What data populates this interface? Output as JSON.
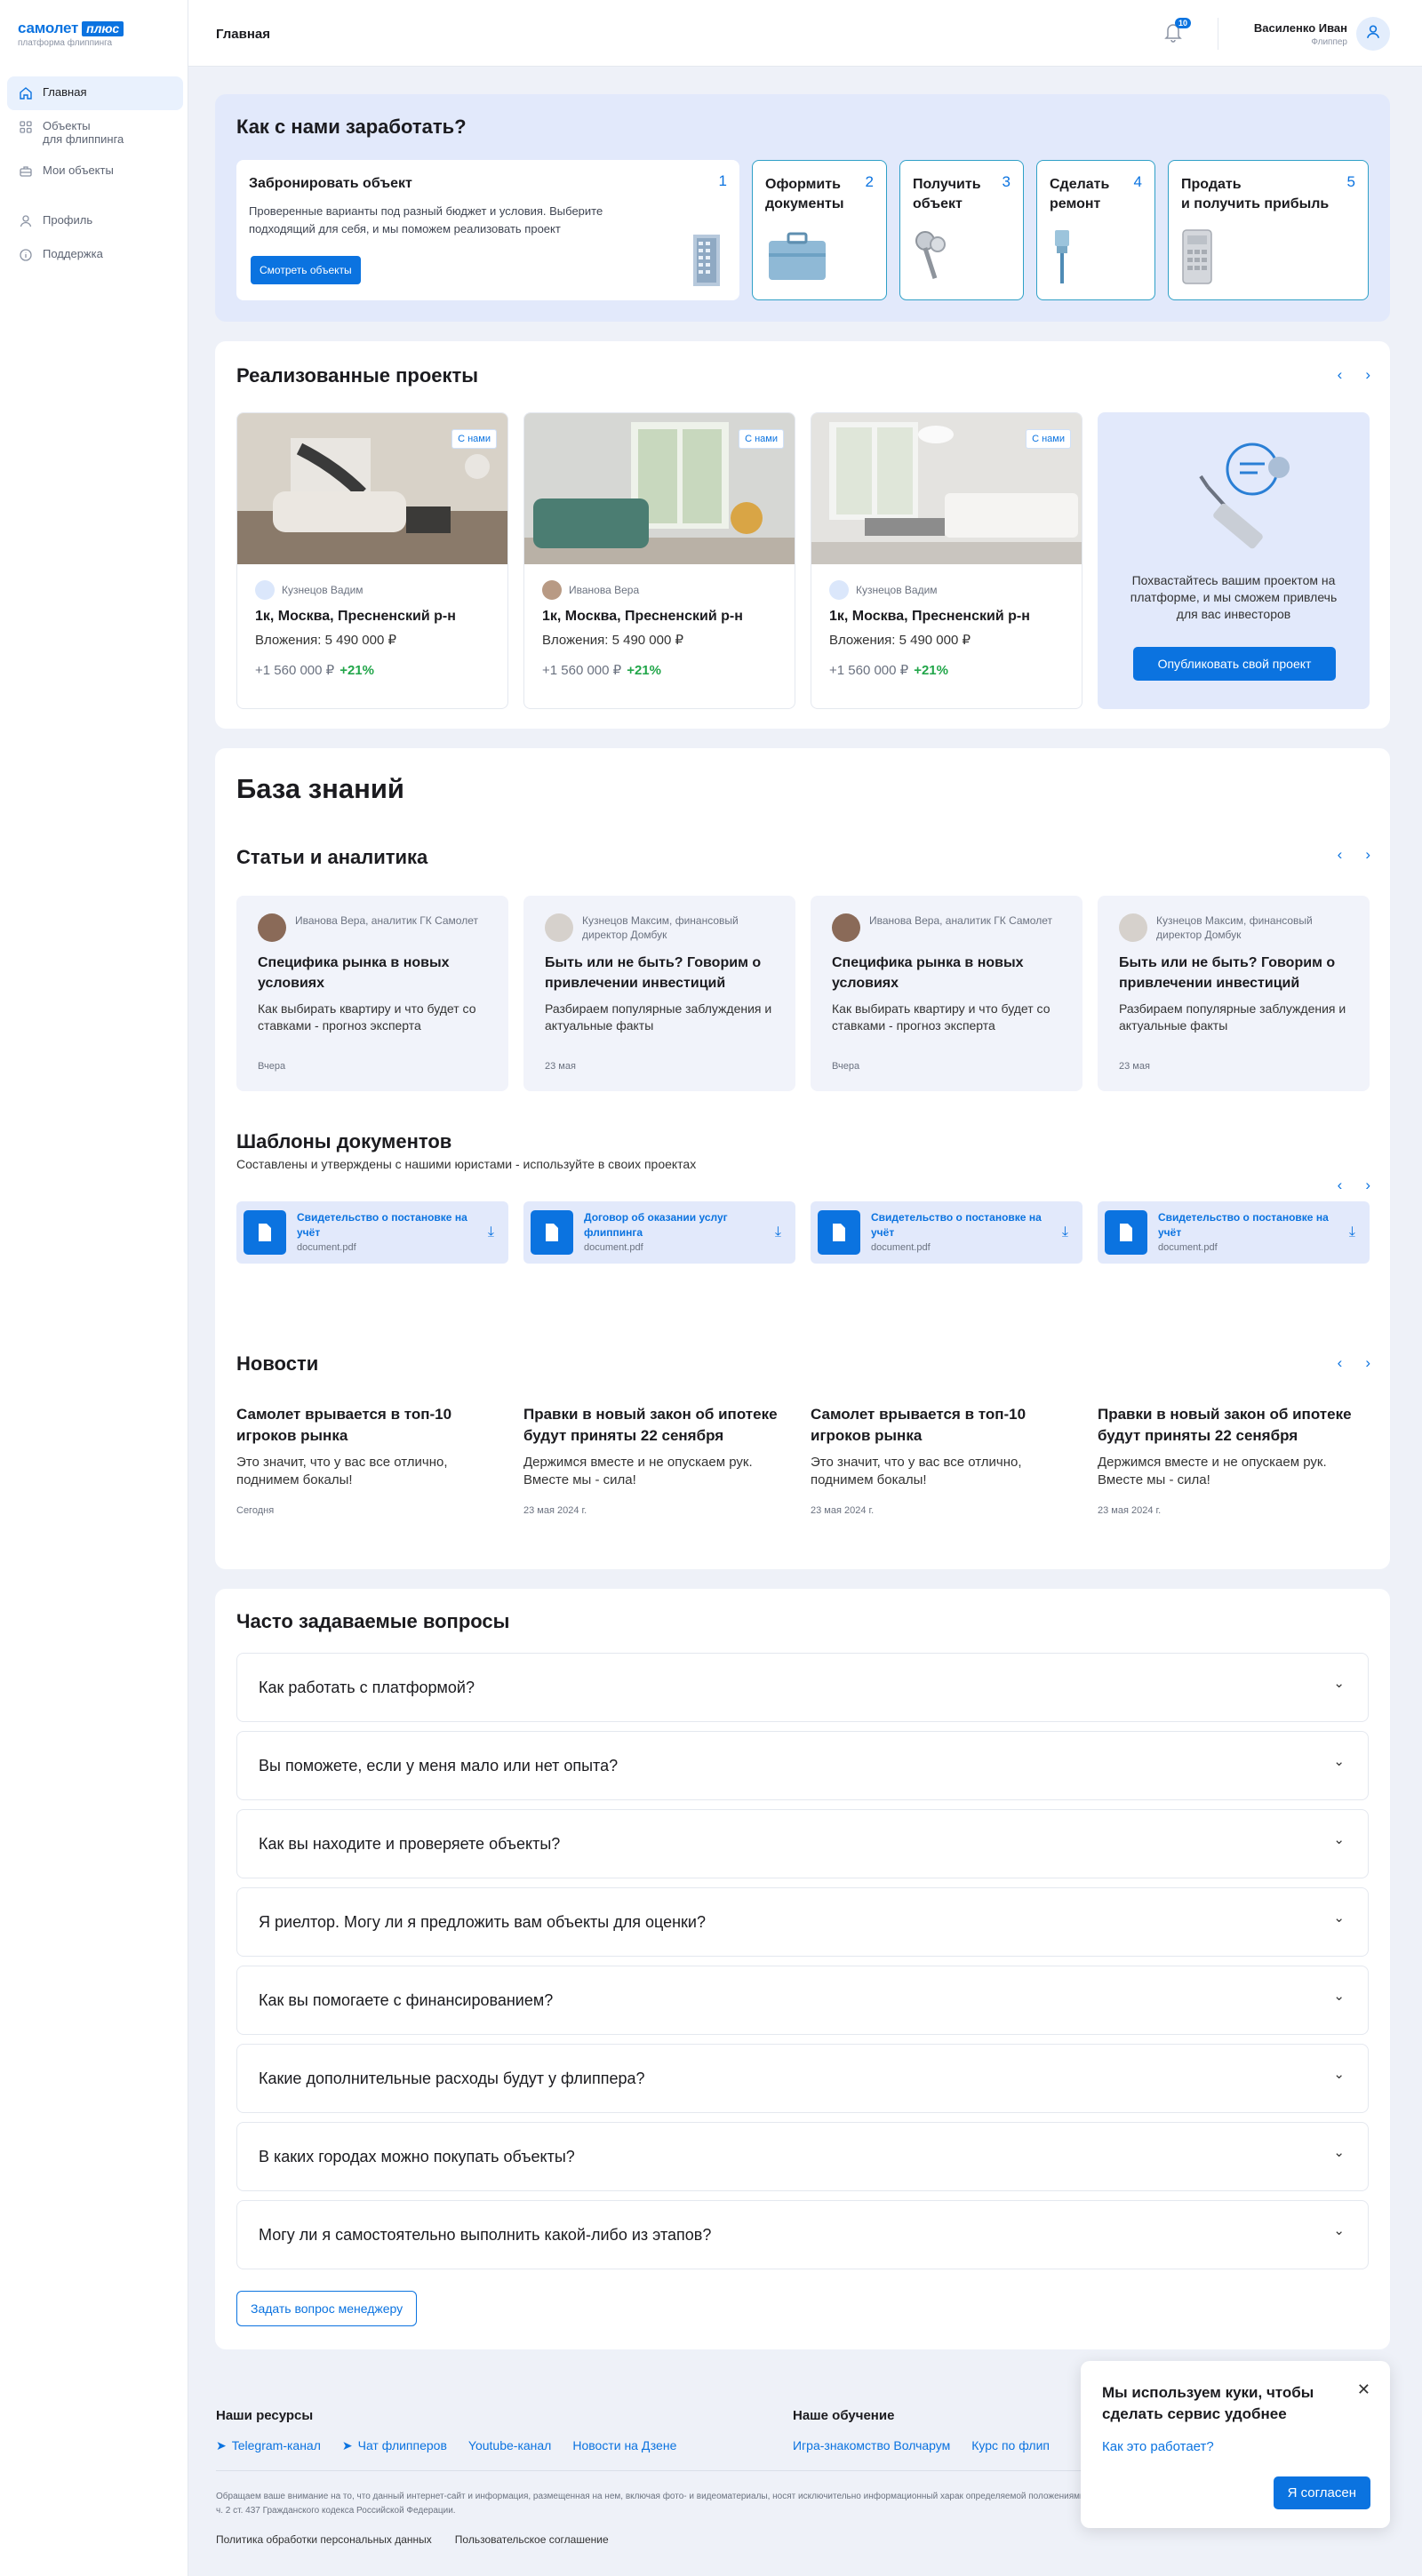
{
  "brand": {
    "name": "самолет",
    "plus": "плюс",
    "tagline": "платформа флиппинга"
  },
  "sidebar": {
    "items": [
      {
        "label": "Главная",
        "icon": "home-icon"
      },
      {
        "label": "Объекты",
        "label2": "для флиппинга",
        "icon": "grid-icon"
      },
      {
        "label": "Мои объекты",
        "icon": "briefcase-icon"
      },
      {
        "label": "Профиль",
        "icon": "person-icon"
      },
      {
        "label": "Поддержка",
        "icon": "info-icon"
      }
    ]
  },
  "header": {
    "breadcrumb": "Главная",
    "notifications": "10",
    "user_name": "Василенко Иван",
    "user_role": "Флиппер"
  },
  "earn": {
    "title": "Как с нами заработать?",
    "steps": [
      {
        "num": "1",
        "title": "Забронировать объект",
        "text": "Проверенные варианты под разный бюджет и условия. Выберите подходящий для себя, и мы поможем реализовать проект",
        "button": "Смотреть объекты"
      },
      {
        "num": "2",
        "title": "Оформить",
        "title2": "документы"
      },
      {
        "num": "3",
        "title": "Получить",
        "title2": "объект"
      },
      {
        "num": "4",
        "title": "Сделать",
        "title2": "ремонт"
      },
      {
        "num": "5",
        "title": "Продать",
        "title2": "и получить прибыль"
      }
    ]
  },
  "projects": {
    "title": "Реализованные проекты",
    "prev": "‹",
    "next": "›",
    "items": [
      {
        "tag": "С нами",
        "author": "Кузнецов Вадим",
        "title": "1к, Москва, Пресненский р-н",
        "invest": "Вложения: 5 490 000 ₽",
        "profit": "+1 560 000 ₽",
        "percent": "+21%"
      },
      {
        "tag": "С нами",
        "author": "Иванова Вера",
        "title": "1к, Москва, Пресненский р-н",
        "invest": "Вложения: 5 490 000 ₽",
        "profit": "+1 560 000 ₽",
        "percent": "+21%"
      },
      {
        "tag": "С нами",
        "author": "Кузнецов Вадим",
        "title": "1к, Москва, Пресненский р-н",
        "invest": "Вложения: 5 490 000 ₽",
        "profit": "+1 560 000 ₽",
        "percent": "+21%"
      }
    ],
    "cta_text": "Похвастайтесь вашим проектом на платформе, и мы сможем привлечь для вас инвесторов",
    "cta_button": "Опубликовать свой проект"
  },
  "knowledge": {
    "title": "База знаний",
    "articles_title": "Статьи и аналитика",
    "articles": [
      {
        "author": "Иванова Вера, аналитик ГК Самолет",
        "title": "Специфика рынка в новых условиях",
        "text": "Как выбирать квартиру и что будет со ставками - прогноз эксперта",
        "date": "Вчера"
      },
      {
        "author": "Кузнецов Максим, финансовый директор Домбук",
        "title": "Быть или не быть? Говорим о привлечении инвестиций",
        "text": "Разбираем популярные заблуждения и актуальные факты",
        "date": "23 мая"
      },
      {
        "author": "Иванова Вера, аналитик ГК Самолет",
        "title": "Специфика рынка в новых условиях",
        "text": "Как выбирать квартиру и что будет со ставками - прогноз эксперта",
        "date": "Вчера"
      },
      {
        "author": "Кузнецов Максим, финансовый директор Домбук",
        "title": "Быть или не быть? Говорим о привлечении инвестиций",
        "text": "Разбираем популярные заблуждения и актуальные факты",
        "date": "23 мая"
      }
    ],
    "templates_title": "Шаблоны документов",
    "templates_subtitle": "Составлены и утверждены с нашими юристами - используйте в своих проектах",
    "templates": [
      {
        "name": "Свидетельство о постановке на учёт",
        "file": "document.pdf"
      },
      {
        "name": "Договор об оказании услуг флиппинга",
        "file": "document.pdf"
      },
      {
        "name": "Свидетельство о постановке на учёт",
        "file": "document.pdf"
      },
      {
        "name": "Свидетельство о постановке на учёт",
        "file": "document.pdf"
      }
    ],
    "news_title": "Новости",
    "news": [
      {
        "title": "Самолет врывается в топ-10 игроков рынка",
        "text": "Это значит, что у вас все отлично, поднимем бокалы!",
        "date": "Сегодня"
      },
      {
        "title": "Правки в новый закон об ипотеке будут приняты 22 сенября",
        "text": "Держимся вместе и не опускаем рук. Вместе мы - сила!",
        "date": "23 мая 2024 г."
      },
      {
        "title": "Самолет врывается в топ-10 игроков рынка",
        "text": "Это значит, что у вас все отлично, поднимем бокалы!",
        "date": "23 мая 2024 г."
      },
      {
        "title": "Правки в новый закон об ипотеке будут приняты 22 сенября",
        "text": "Держимся вместе и не опускаем рук. Вместе мы - сила!",
        "date": "23 мая 2024 г."
      }
    ]
  },
  "faq": {
    "title": "Часто задаваемые вопросы",
    "items": [
      "Как работать с платформой?",
      "Вы поможете, если у меня мало или нет опыта?",
      "Как вы находите и проверяете объекты?",
      "Я риелтор. Могу ли я предложить вам объекты для оценки?",
      "Как вы помогаете с финансированием?",
      "Какие дополнительные расходы будут у флиппера?",
      "В каких городах можно покупать объекты?",
      "Могу ли я самостоятельно выполнить какой-либо из этапов?"
    ],
    "ask_button": "Задать вопрос менеджеру"
  },
  "footer": {
    "resources_title": "Наши ресурсы",
    "resources": [
      "Telegram-канал",
      "Чат флипперов",
      "Youtube-канал",
      "Новости на Дзене"
    ],
    "learning_title": "Наше обучение",
    "learning": [
      "Игра-знакомство Волчарум",
      "Курс по флип"
    ],
    "disclaimer": "Обращаем ваше внимание на то, что данный интернет-сайт и информация, размещенная на нем, включая фото- и видеоматериалы, носят исключительно информационный харак определяемой положениями ч. 2 ст. 437 Гражданского кодекса Российской Федерации.",
    "disclaimer2": "определяемой положениями ч. 2 ст. 437 Гражданского кодекса Российской Федерации.",
    "legal": [
      "Политика обработки персональных данных",
      "Пользовательское соглашение"
    ]
  },
  "cookie": {
    "text": "Мы используем куки, чтобы сделать сервис удобнее",
    "link": "Как это работает?",
    "button": "Я согласен"
  },
  "colors": {
    "accent": "#0b73e0",
    "profit": "#22a64a",
    "soft_bg": "#e2e9fb",
    "page_bg": "#eef1f8"
  }
}
